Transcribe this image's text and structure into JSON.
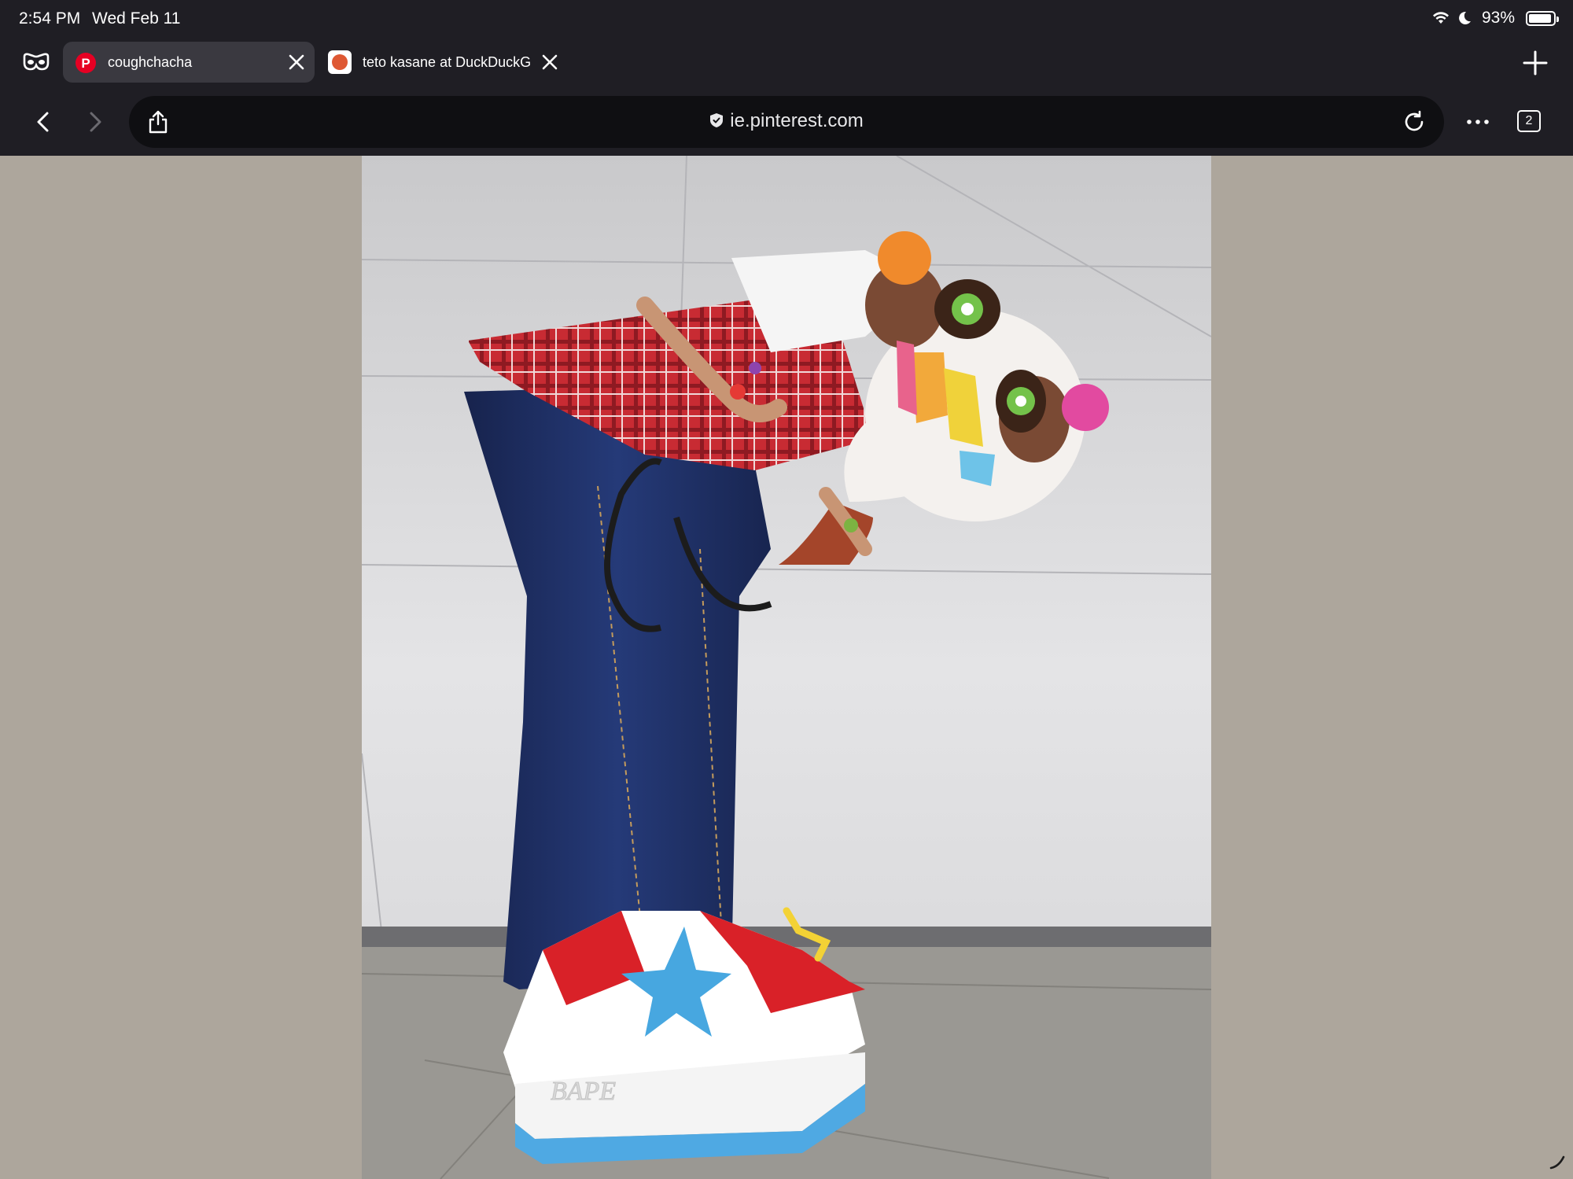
{
  "status_bar": {
    "time": "2:54 PM",
    "date": "Wed Feb 11",
    "battery_percent": "93%",
    "battery_level": 0.93,
    "icons": [
      "wifi-icon",
      "moon-icon",
      "battery-icon"
    ]
  },
  "tabs": [
    {
      "title": "coughchacha",
      "active": true,
      "favicon": "pinterest-favicon"
    },
    {
      "title": "teto kasane at DuckDuckG",
      "active": false,
      "favicon": "duckduckgo-favicon"
    }
  ],
  "toolbar": {
    "url": "ie.pinterest.com",
    "tab_count": "2",
    "icons": [
      "private-mode-icon",
      "back-icon",
      "forward-icon",
      "share-icon",
      "lock-icon",
      "reload-icon",
      "more-icon",
      "new-tab-icon"
    ]
  },
  "colors": {
    "chrome_background": "#1f1e24",
    "active_tab": "#3a3940",
    "url_bar": "#0f0f12",
    "page_background": "#ada69c",
    "pinterest_red": "#e60023"
  }
}
